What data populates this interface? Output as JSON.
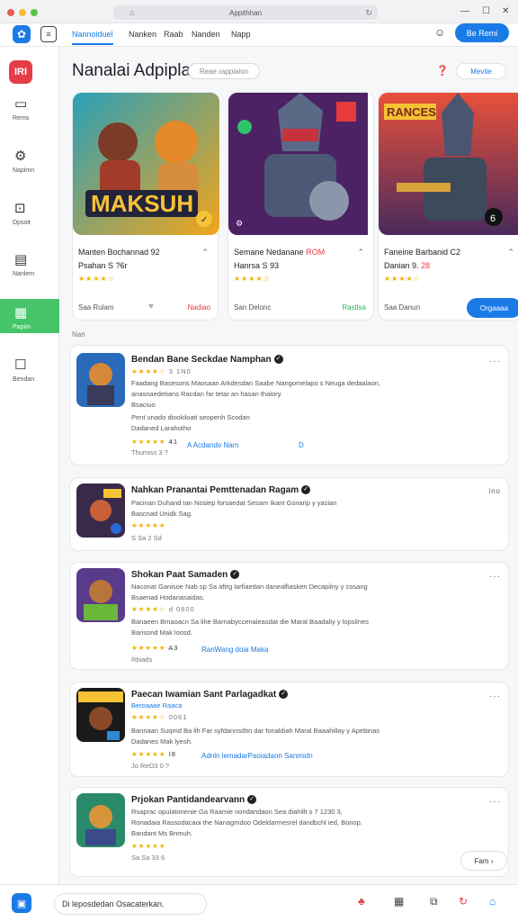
{
  "window": {
    "url_title": "Appithhan",
    "url_left_icon": "lock-icon",
    "url_right_icon": "reload-icon",
    "dots": [
      "#ee5b55",
      "#f5bd3c",
      "#56c443"
    ]
  },
  "topnav": {
    "tabs": [
      {
        "label": "Nannoiduel",
        "active": true
      },
      {
        "label": "Nanken"
      },
      {
        "label": "Raab"
      },
      {
        "label": "Nanden"
      },
      {
        "label": "Napp"
      }
    ],
    "signin_label": "Be Remi"
  },
  "sidebar": {
    "logo_text": "IRI",
    "items": [
      {
        "label": "Rems",
        "icon": "folder-icon"
      },
      {
        "label": "Napimn",
        "icon": "gear-icon"
      },
      {
        "label": "Dpsoit",
        "icon": "download-icon"
      },
      {
        "label": "Nanlem",
        "icon": "document-icon"
      },
      {
        "label": "Papim",
        "icon": "grid-icon",
        "active": true
      },
      {
        "label": "Bendan",
        "icon": "chat-icon"
      }
    ]
  },
  "header": {
    "title": "Nanalai Adpiplan",
    "search_placeholder": "Reae rappiaion",
    "button_label": "Mevtie"
  },
  "featured": [
    {
      "title": "Manten Bochannad 92",
      "subtitle": "Psahan S ?6r",
      "source": "Saa Rulam",
      "action": "Nadiao",
      "art_text": "MAKSUH",
      "art_badge": "✓"
    },
    {
      "title": "Semane Nedanane",
      "title_accent": "ROM",
      "subtitle": "Hanrsa S 93",
      "source": "San Delonc",
      "action": "Rastlsa",
      "art_badge": "⚙"
    },
    {
      "title": "Faneine Barbanid C2",
      "subtitle": "Danian 9.",
      "subtitle_2": "28",
      "source": "Saa Danun",
      "button_label": "Orgaaaa",
      "art_text": "RANCES",
      "art_badge": "6"
    }
  ],
  "section_label": "Nan",
  "apps": [
    {
      "name": "Bendan Bane Seckdae Namphan",
      "stars": "★★★★☆",
      "stars_note": "3 1N0",
      "lines": [
        "Faadang Basesons Maosaan Arkdesdan Saabe Nangomelapo s Neuga dedaalaon,",
        "anasnaedetians Racdan far tetar an hasan thalory.",
        "Bsaciuo",
        "Pent unado disokiloati seopenh Scodan",
        "Dadaned Larahotho"
      ],
      "rating_stars": "★★★★★",
      "rating": "41",
      "link": "A  Acdando Nam",
      "link_extra": "D",
      "meta": "Thumiss  3  ?"
    },
    {
      "name": "Nahkan Pranantai Pemttenadan Ragam",
      "more_text": "ino",
      "lines": [
        "Pacinan Duhand Ian Nosiep forsaedat Sesam Ikant Gsnarip y yasian",
        "Bascnad Unidk Sag."
      ],
      "rating_stars": "★★★★★",
      "meta": "S  Sa  2  Sd"
    },
    {
      "name": "Shokan Paat Samaden",
      "lines": [
        "Naconat Ganisoe Nab sp Sa aftrg larfiaedan danealfiasken Decapilny y cosang",
        "Bsaenad Hodanasaidas."
      ],
      "stars": "★★★★☆",
      "stars_note": "d 0800",
      "lines_2": [
        "Banaeen Bmaoacn Sa lihe Barnabyccenaleasdat die Maral Baadaliy y lopsilnes",
        "Barisond Mak loosd."
      ],
      "rating_stars": "★★★★★",
      "rating": "A3",
      "link": "RanWang doia Maka",
      "meta": "Rbiads"
    },
    {
      "name": "Paecan Iwamian Sant Parlagadkat",
      "subtitle": "Beroaaae Raaca",
      "stars": "★★★★☆",
      "stars_note": "0061",
      "lines": [
        "Banriaan Suqmd Ba lih  Far syfdannsdtin dar fonaldiah  Maral Baaahillay y Apebinas",
        "Dadanes Mak lyesh."
      ],
      "rating_stars": "★★★★★",
      "rating": "I8",
      "link": "Adnln lemadarPaoiadaon Sanmidn",
      "meta": "Jo  ReO3 0  ?"
    },
    {
      "name": "Prjokan Pantidandearvann",
      "lines": [
        "Rsaprac opulatonenie Ga Raamie nondandaon Sea diahillt s 7 1230 3,",
        "Ronadaia Rassodacaoi the Nanagmdoo Odeldarmesrel dandbchl ied, Bonop.",
        "Bandant Ms Bnmuh."
      ],
      "rating_stars": "★★★★★",
      "meta": "Sa  Sa  33  6"
    }
  ],
  "float_button_label": "Fam ›",
  "bottombar": {
    "input_text": "Di leposdedan Osacaterkan."
  },
  "colors": {
    "accent": "#1a7ae6",
    "active_green": "#46c46a",
    "brand_red": "#e53d45",
    "star": "#f4b000"
  }
}
